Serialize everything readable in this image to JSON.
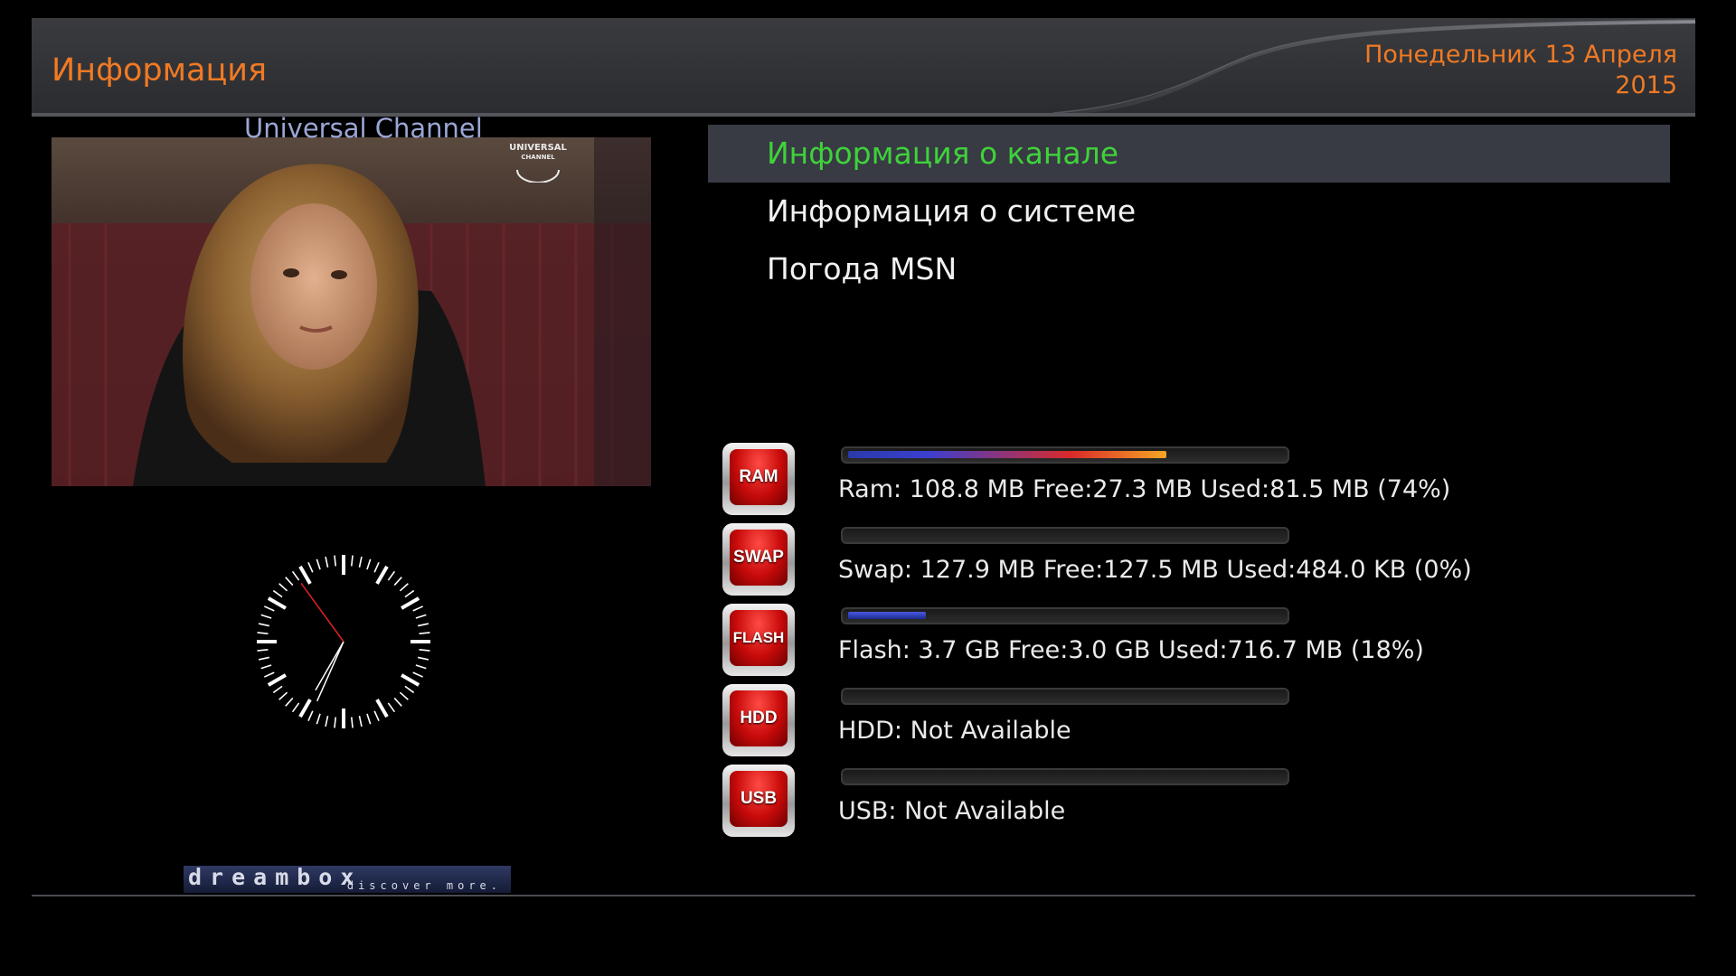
{
  "header": {
    "title": "Информация",
    "date_line1": "Понедельник 13 Апреля",
    "date_line2": "2015"
  },
  "preview": {
    "channel_name": "Universal Channel",
    "logo_text_1": "UNIVERSAL",
    "logo_text_2": "CHANNEL"
  },
  "clock": {
    "hour_hand": 7.0,
    "minute_hand": 34,
    "second_hand": 54
  },
  "menu": {
    "items": [
      {
        "label": "Информация о канале",
        "selected": true
      },
      {
        "label": "Информация о системе",
        "selected": false
      },
      {
        "label": "Погода MSN",
        "selected": false
      }
    ]
  },
  "stats": [
    {
      "icon": "RAM",
      "text": "Ram: 108.8 MB Free:27.3 MB Used:81.5 MB (74%)",
      "percent": 74
    },
    {
      "icon": "SWAP",
      "text": "Swap: 127.9 MB Free:127.5 MB Used:484.0 KB (0%)",
      "percent": 0
    },
    {
      "icon": "FLASH",
      "text": "Flash: 3.7 GB Free:3.0 GB Used:716.7 MB (18%)",
      "percent": 18
    },
    {
      "icon": "HDD",
      "text": "HDD: Not Available",
      "percent": 0
    },
    {
      "icon": "USB",
      "text": "USB: Not Available",
      "percent": 0
    }
  ],
  "footer": {
    "brand": "dreambox",
    "tagline": "discover more."
  },
  "colors": {
    "accent": "#f07a24",
    "selected_text": "#3fd23a",
    "channel_name": "#9aa6d4",
    "badge_red": "#c70a0a"
  }
}
